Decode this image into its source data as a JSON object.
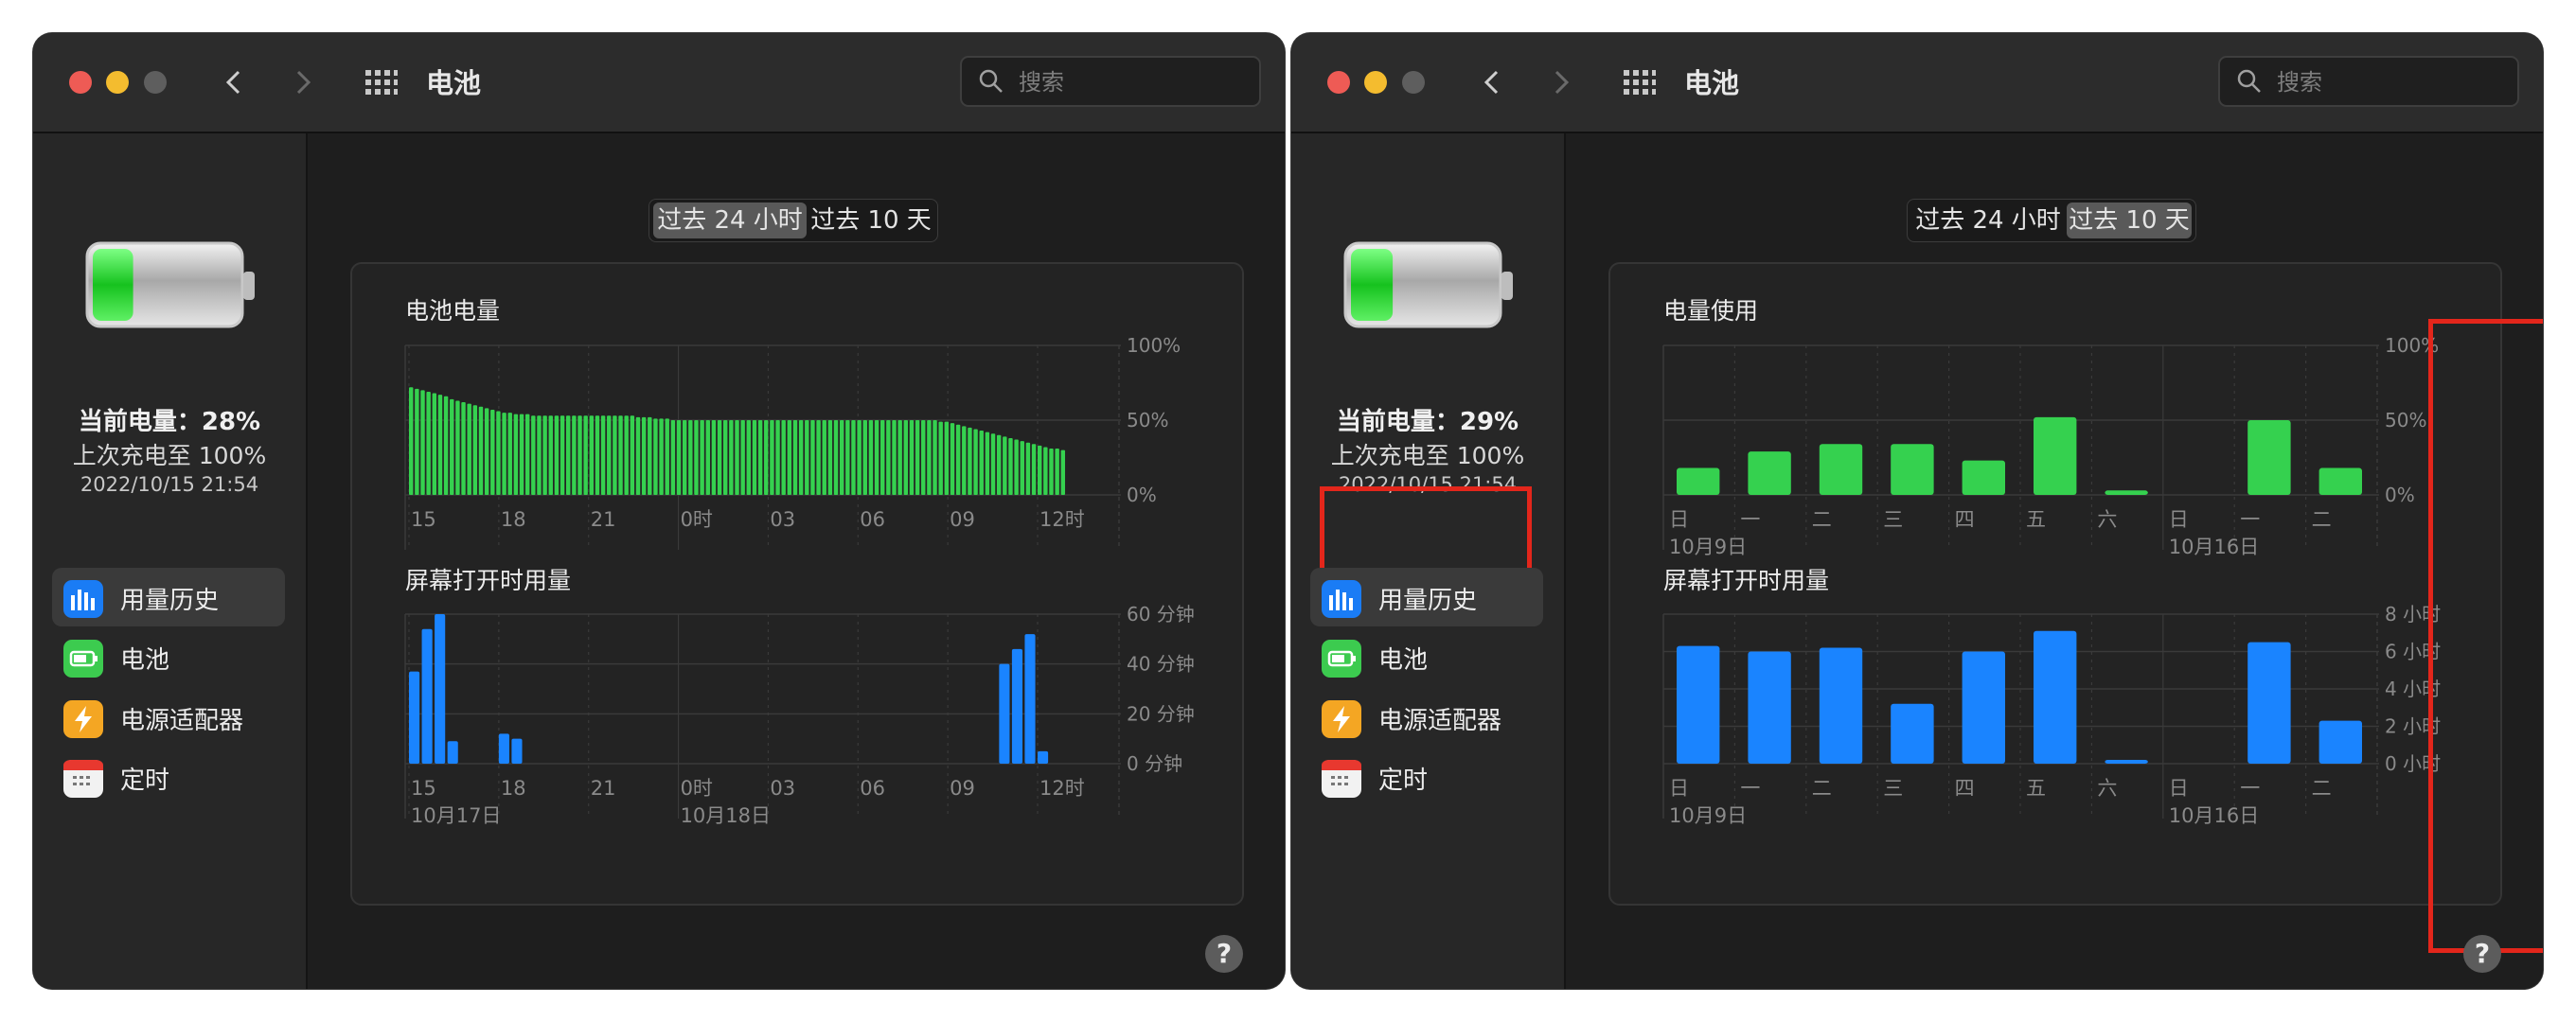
{
  "colors": {
    "battery_green": "#35d14f",
    "screen_blue": "#1a84ff",
    "highlight_red": "#e3261b",
    "window_bg": "#1e1e1e"
  },
  "windows": [
    {
      "title": "电池",
      "search": {
        "placeholder": "搜索"
      },
      "status": {
        "current": "当前电量：28%",
        "last_charge": "上次充电至 100%",
        "date": "2022/10/15 21:54"
      },
      "sidebar": {
        "items": [
          {
            "label": "用量历史",
            "icon": "bar-chart-icon",
            "selected": true
          },
          {
            "label": "电池",
            "icon": "battery-icon",
            "selected": false
          },
          {
            "label": "电源适配器",
            "icon": "lightning-icon",
            "selected": false
          },
          {
            "label": "定时",
            "icon": "calendar-icon",
            "selected": false
          }
        ]
      },
      "segmented": {
        "options": [
          "过去 24 小时",
          "过去 10 天"
        ],
        "selected": 0
      },
      "help_label": "?"
    },
    {
      "title": "电池",
      "search": {
        "placeholder": "搜索"
      },
      "status": {
        "current": "当前电量：29%",
        "last_charge": "上次充电至 100%",
        "date": "2022/10/15 21:54"
      },
      "sidebar": {
        "items": [
          {
            "label": "用量历史",
            "icon": "bar-chart-icon",
            "selected": true
          },
          {
            "label": "电池",
            "icon": "battery-icon",
            "selected": false
          },
          {
            "label": "电源适配器",
            "icon": "lightning-icon",
            "selected": false
          },
          {
            "label": "定时",
            "icon": "calendar-icon",
            "selected": false
          }
        ]
      },
      "segmented": {
        "options": [
          "过去 24 小时",
          "过去 10 天"
        ],
        "selected": 1
      },
      "help_label": "?"
    }
  ],
  "chart_data": [
    {
      "type": "bar",
      "title": "电池电量",
      "ylim": [
        0,
        100
      ],
      "yticks": [
        "100%",
        "50%",
        "0%"
      ],
      "xticks": [
        "15",
        "18",
        "21",
        "0时",
        "03",
        "06",
        "09",
        "12时"
      ],
      "values": [
        72,
        71,
        70,
        69,
        68,
        67,
        66,
        64,
        63,
        62,
        61,
        60,
        59,
        58,
        57,
        56,
        55,
        55,
        54,
        54,
        54,
        53,
        53,
        53,
        53,
        53,
        53,
        53,
        53,
        53,
        53,
        53,
        53,
        53,
        53,
        53,
        53,
        53,
        53,
        52,
        52,
        52,
        51,
        51,
        51,
        50,
        50,
        50,
        50,
        50,
        50,
        50,
        50,
        50,
        50,
        50,
        50,
        50,
        50,
        50,
        50,
        50,
        50,
        50,
        50,
        50,
        50,
        50,
        50,
        50,
        50,
        50,
        50,
        50,
        50,
        50,
        50,
        50,
        50,
        50,
        50,
        50,
        50,
        50,
        50,
        50,
        50,
        50,
        50,
        50,
        50,
        49,
        49,
        48,
        47,
        46,
        45,
        44,
        43,
        42,
        41,
        40,
        39,
        38,
        37,
        36,
        35,
        34,
        33,
        32,
        31,
        31,
        30
      ],
      "grid": true
    },
    {
      "type": "bar",
      "title": "屏幕打开时用量",
      "ylim": [
        0,
        60
      ],
      "yticks": [
        "60 分钟",
        "40 分钟",
        "20 分钟",
        "0 分钟"
      ],
      "xticks": [
        "15",
        "18",
        "21",
        "0时",
        "03",
        "06",
        "09",
        "12时"
      ],
      "date_labels": [
        "10月17日",
        "10月18日"
      ],
      "values": [
        37,
        54,
        60,
        9,
        0,
        0,
        0,
        12,
        10,
        0,
        0,
        0,
        0,
        0,
        0,
        0,
        0,
        0,
        0,
        0,
        0,
        0,
        0,
        0,
        0,
        0,
        0,
        0,
        0,
        0,
        0,
        0,
        0,
        0,
        0,
        0,
        0,
        0,
        0,
        0,
        0,
        0,
        0,
        0,
        0,
        0,
        40,
        46,
        52,
        5
      ],
      "grid": true
    },
    {
      "type": "bar",
      "title": "电量使用",
      "ylim": [
        0,
        100
      ],
      "yticks": [
        "100%",
        "50%",
        "0%"
      ],
      "categories": [
        "日",
        "一",
        "二",
        "三",
        "四",
        "五",
        "六",
        "日",
        "一",
        "二"
      ],
      "values": [
        18,
        29,
        34,
        34,
        23,
        52,
        3,
        0,
        50,
        18
      ],
      "date_labels": [
        "10月9日",
        "10月16日"
      ],
      "grid": true
    },
    {
      "type": "bar",
      "title": "屏幕打开时用量",
      "ylim": [
        0,
        8
      ],
      "yticks": [
        "8 小时",
        "6 小时",
        "4 小时",
        "2 小时",
        "0 小时"
      ],
      "categories": [
        "日",
        "一",
        "二",
        "三",
        "四",
        "五",
        "六",
        "日",
        "一",
        "二"
      ],
      "values": [
        6.3,
        6.0,
        6.2,
        3.2,
        6.0,
        7.1,
        0.2,
        0,
        6.5,
        2.3
      ],
      "date_labels": [
        "10月9日",
        "10月16日"
      ],
      "grid": true
    }
  ]
}
